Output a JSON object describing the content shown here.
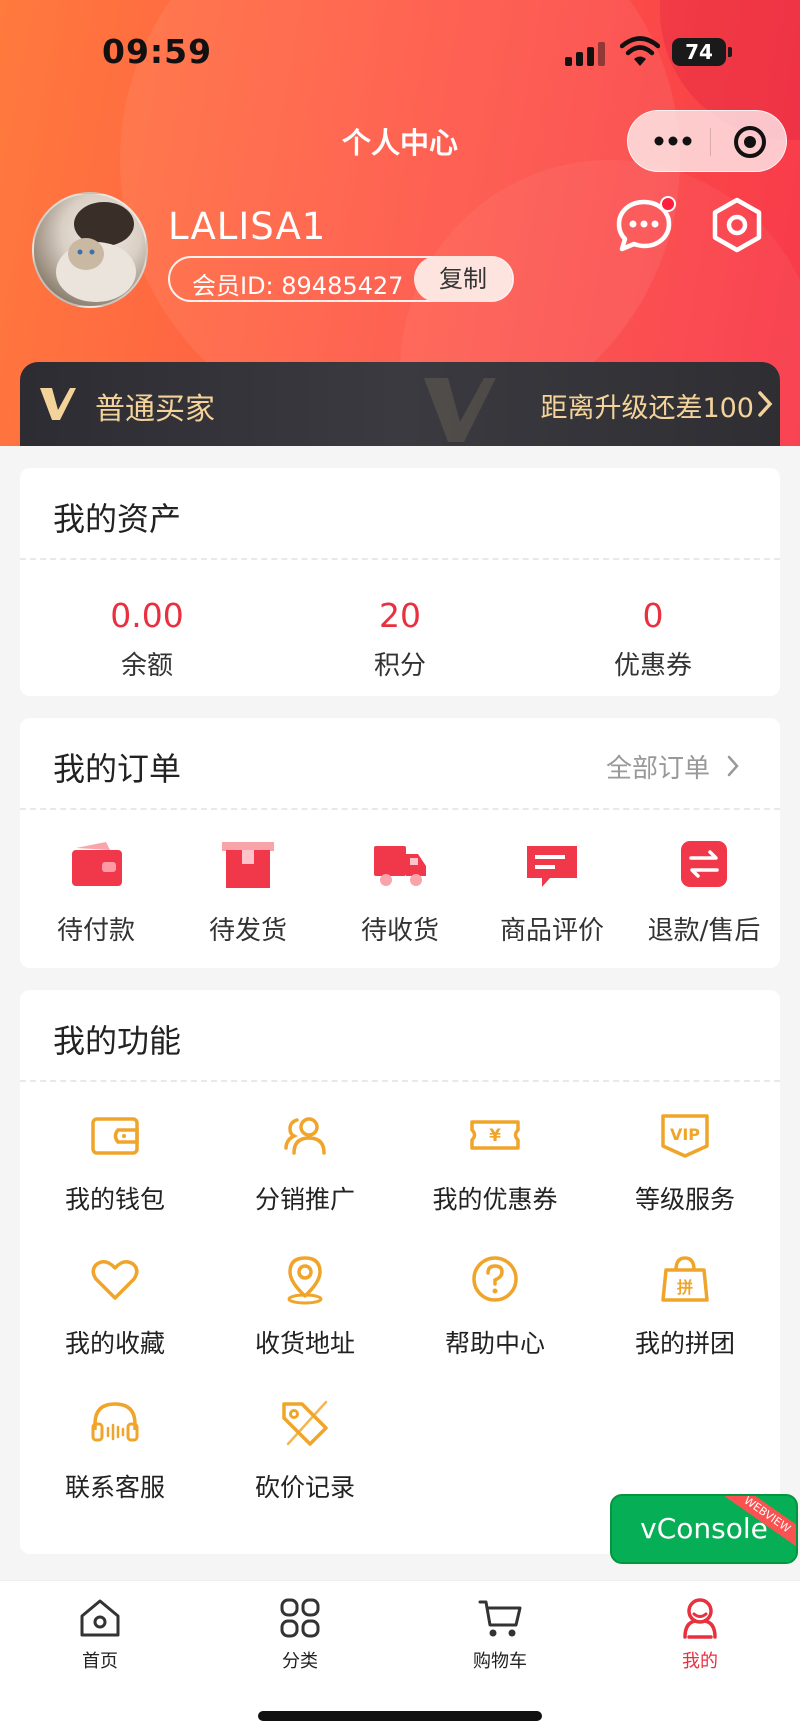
{
  "status_bar": {
    "time": "09:59",
    "battery": "74"
  },
  "nav": {
    "title": "个人中心",
    "more_icon": "more-dots-icon",
    "close_icon": "target-icon"
  },
  "profile": {
    "username": "LALISA1",
    "member_id": "会员ID: 89485427",
    "copy_label": "复制",
    "has_unread_message": true
  },
  "level": {
    "name": "普通买家",
    "upgrade_hint": "距离升级还差100"
  },
  "assets": {
    "title": "我的资产",
    "items": [
      {
        "value": "0.00",
        "label": "余额"
      },
      {
        "value": "20",
        "label": "积分"
      },
      {
        "value": "0",
        "label": "优惠券"
      }
    ]
  },
  "orders": {
    "title": "我的订单",
    "all_label": "全部订单",
    "items": [
      {
        "label": "待付款",
        "icon": "wallet-icon"
      },
      {
        "label": "待发货",
        "icon": "box-icon"
      },
      {
        "label": "待收货",
        "icon": "truck-icon"
      },
      {
        "label": "商品评价",
        "icon": "comment-icon"
      },
      {
        "label": "退款/售后",
        "icon": "exchange-icon"
      }
    ]
  },
  "functions": {
    "title": "我的功能",
    "items": [
      {
        "label": "我的钱包",
        "icon": "wallet-outline-icon"
      },
      {
        "label": "分销推广",
        "icon": "users-icon"
      },
      {
        "label": "我的优惠券",
        "icon": "coupon-icon"
      },
      {
        "label": "等级服务",
        "icon": "vip-icon"
      },
      {
        "label": "我的收藏",
        "icon": "heart-icon"
      },
      {
        "label": "收货地址",
        "icon": "location-icon"
      },
      {
        "label": "帮助中心",
        "icon": "help-icon"
      },
      {
        "label": "我的拼团",
        "icon": "group-buy-icon"
      },
      {
        "label": "联系客服",
        "icon": "headset-icon"
      },
      {
        "label": "砍价记录",
        "icon": "price-tag-icon"
      }
    ]
  },
  "vconsole": {
    "label": "vConsole",
    "tag": "WEBVIEW"
  },
  "tabbar": {
    "items": [
      {
        "label": "首页",
        "icon": "home-icon"
      },
      {
        "label": "分类",
        "icon": "grid-icon"
      },
      {
        "label": "购物车",
        "icon": "cart-icon"
      },
      {
        "label": "我的",
        "icon": "user-icon",
        "active": true
      }
    ]
  },
  "colors": {
    "accent": "#e8303f",
    "header_start": "#ff7a3d",
    "header_end": "#f8394a",
    "gold": "#f3d39a",
    "icon_orange": "#f0a52a"
  }
}
